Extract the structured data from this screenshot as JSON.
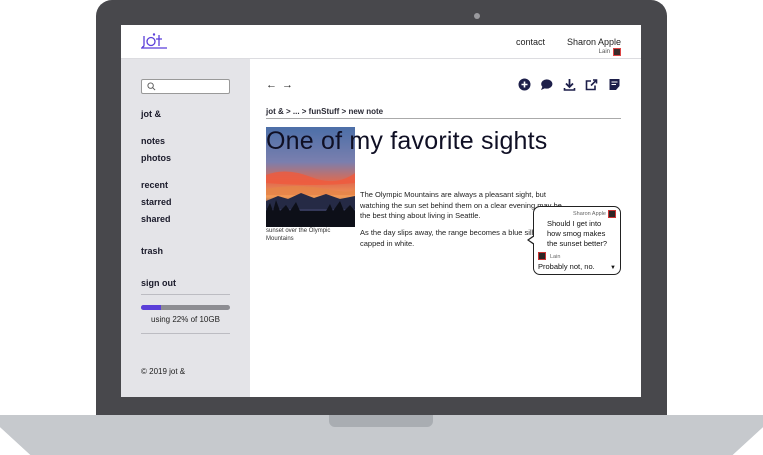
{
  "header": {
    "logo_text": "jot &",
    "contact": "contact",
    "user_name": "Sharon Apple",
    "user_sub": "Lain"
  },
  "sidebar": {
    "search_placeholder": "",
    "items": [
      {
        "label": "jot &"
      },
      {
        "label": "notes"
      },
      {
        "label": "photos"
      },
      {
        "label": "recent"
      },
      {
        "label": "starred"
      },
      {
        "label": "shared"
      },
      {
        "label": "trash"
      },
      {
        "label": "sign out"
      }
    ],
    "storage_text": "using 22% of 10GB",
    "storage_fraction": 0.22,
    "copyright": "© 2019 jot &"
  },
  "toolbar": {
    "back": "←",
    "forward": "→",
    "icons": [
      "add-icon",
      "comment-icon",
      "download-icon",
      "share-icon",
      "notes-icon"
    ]
  },
  "breadcrumb": "jot & > ... > funStuff > new note",
  "note": {
    "title": "One of my favorite sights",
    "photo_caption": "sunset over the Olympic Mountains",
    "paragraph1": "The Olympic Mountains are always a pleasant sight, but watching the sun set behind them on a clear evening may be the best thing about living in Seattle.",
    "paragraph2": "As the day slips away, the range becomes a blue silhouette capped in white."
  },
  "comment": {
    "author": "Sharon Apple",
    "text": "Should I get into how smog makes the sunset better?",
    "reply_author": "Lain",
    "reply": "Probably not, no."
  },
  "colors": {
    "accent": "#5b3fd9",
    "sidebar_bg": "#e4e4e8",
    "laptop": "#48484c"
  }
}
